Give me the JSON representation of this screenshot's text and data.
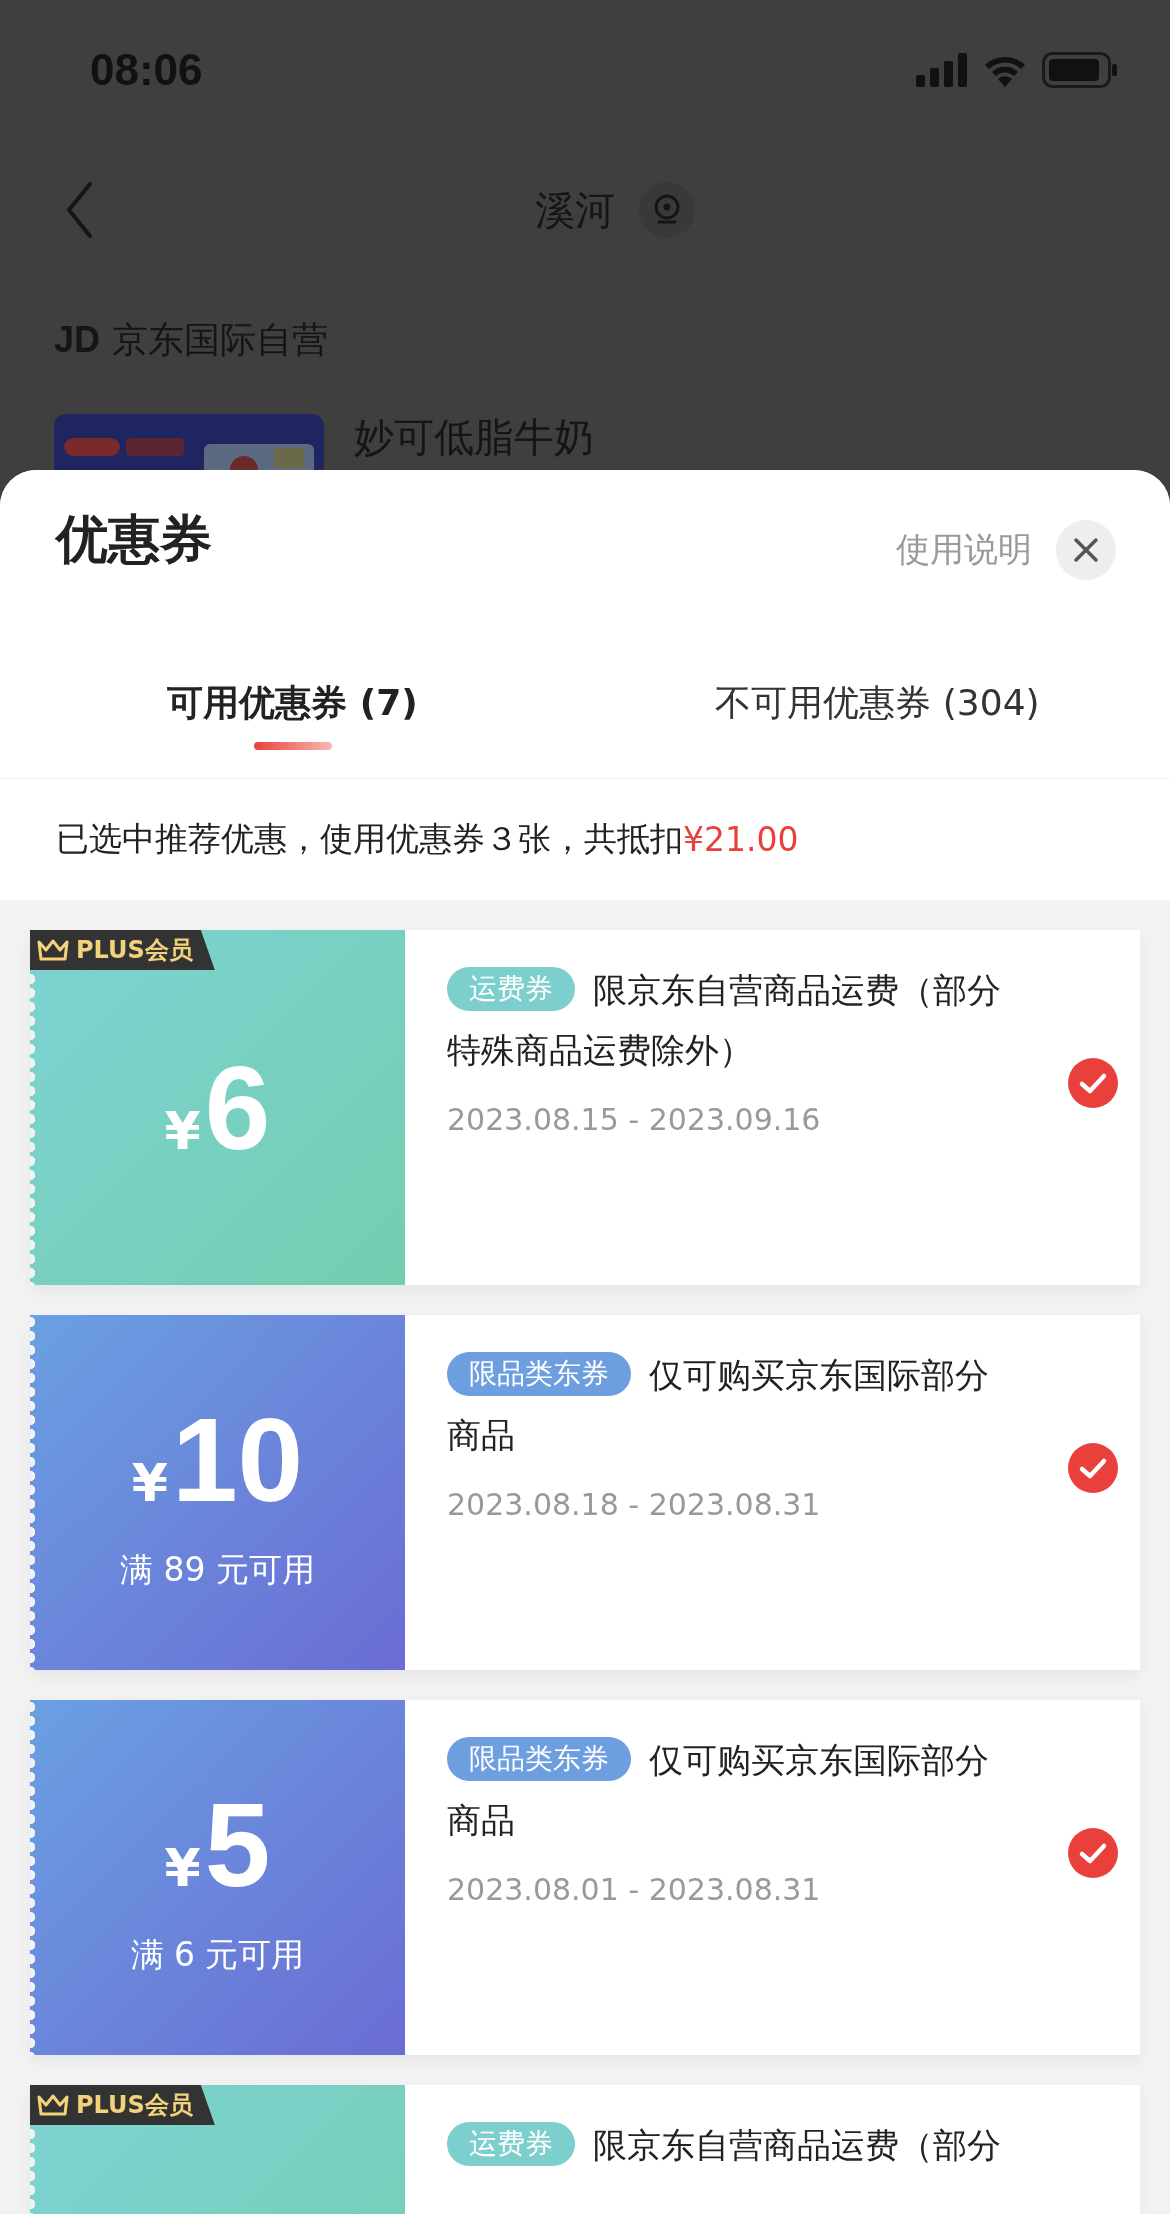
{
  "status_bar": {
    "time": "08:06"
  },
  "nav": {
    "title": "溪河"
  },
  "store": {
    "logo": "JD",
    "name": "京东国际自营"
  },
  "product": {
    "name": "妙可低脂牛奶"
  },
  "sheet": {
    "title": "优惠券",
    "help_link": "使用说明",
    "tabs": [
      {
        "label": "可用优惠券 (7)",
        "selected": true
      },
      {
        "label": "不可用优惠券 (304)",
        "selected": false
      }
    ],
    "summary": {
      "text": "已选中推荐优惠，使用优惠券３张，共抵扣",
      "amount": "¥21.00"
    },
    "coupons": [
      {
        "kind": "shipping",
        "plus_badge": "PLUS会员",
        "currency": "¥",
        "amount": "6",
        "tag": "运费券",
        "description": "限京东自营商品运费（部分特殊商品运费除外）",
        "dates": "2023.08.15 - 2023.09.16",
        "selected": true
      },
      {
        "kind": "category",
        "currency": "¥",
        "amount": "10",
        "condition": "满 89 元可用",
        "tag": "限品类东券",
        "description": "仅可购买京东国际部分商品",
        "dates": "2023.08.18 - 2023.08.31",
        "selected": true
      },
      {
        "kind": "category",
        "currency": "¥",
        "amount": "5",
        "condition": "满 6 元可用",
        "tag": "限品类东券",
        "description": "仅可购买京东国际部分商品",
        "dates": "2023.08.01 - 2023.08.31",
        "selected": true
      },
      {
        "kind": "shipping",
        "plus_badge": "PLUS会员",
        "tag": "运费券",
        "description": "限京东自营商品运费（部分"
      }
    ]
  }
}
